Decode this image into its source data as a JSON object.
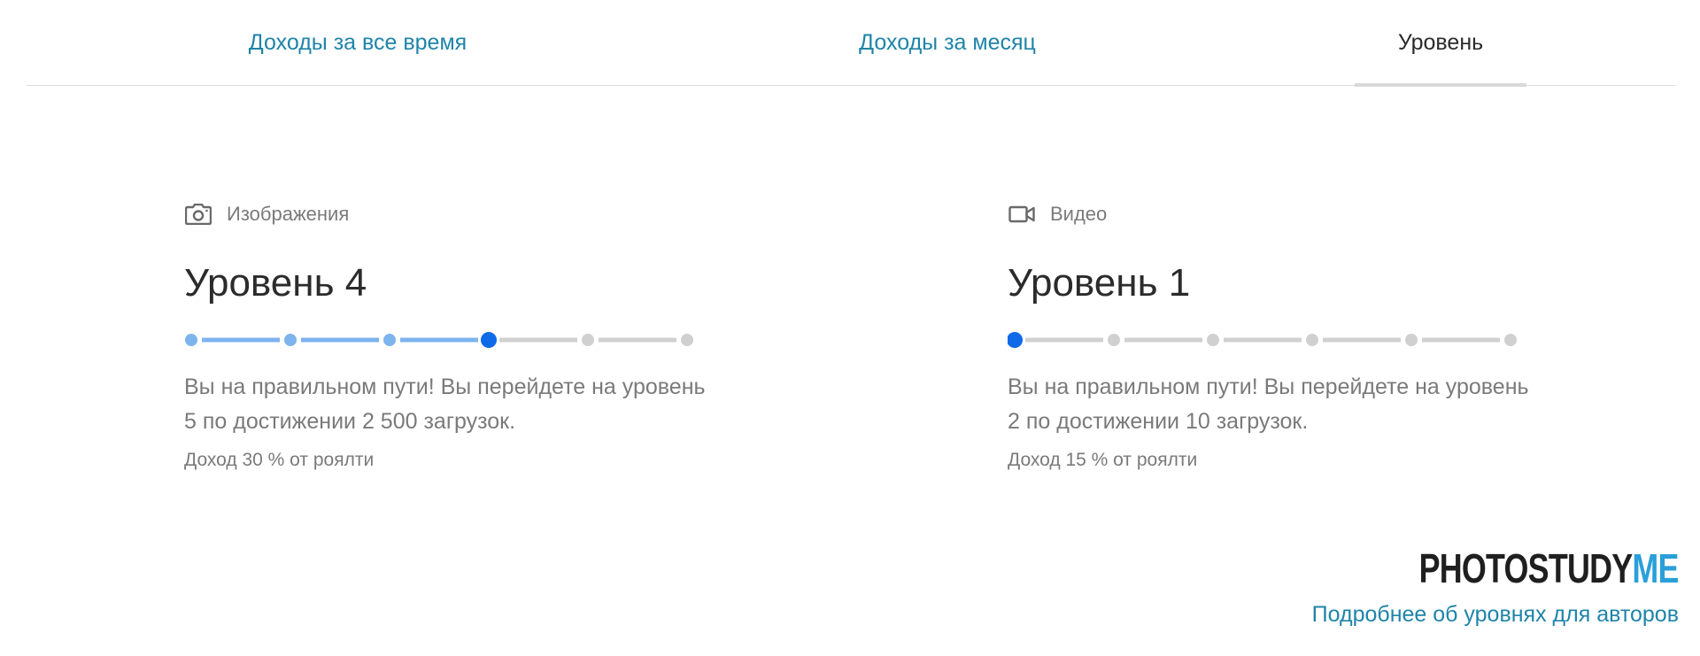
{
  "tabs": [
    {
      "label": "Доходы за все время",
      "active": false
    },
    {
      "label": "Доходы за месяц",
      "active": false
    },
    {
      "label": "Уровень",
      "active": true
    }
  ],
  "levels": [
    {
      "icon": "camera-icon",
      "type_label": "Изображения",
      "title": "Уровень 4",
      "current_level": 4,
      "total_levels": 6,
      "description": "Вы на правильном пути! Вы перейдете на уровень 5 по достижении 2 500 загрузок.",
      "royalty": "Доход 30 % от роялти"
    },
    {
      "icon": "video-camera-icon",
      "type_label": "Видео",
      "title": "Уровень 1",
      "current_level": 1,
      "total_levels": 6,
      "description": "Вы на правильном пути! Вы перейдете на уровень 2 по достижении 10 загрузок.",
      "royalty": "Доход 15 % от роялти"
    }
  ],
  "colors": {
    "link": "#1f84a9",
    "progress_done": "#7eb4ee",
    "progress_current": "#0f6ae8",
    "progress_todo": "#d0d0d0",
    "logo_accent": "#2b9fd8"
  },
  "logo": {
    "part1": "PHOTOSTUDY",
    "part2": "ME"
  },
  "footer": {
    "more_link": "Подробнее об уровнях для авторов"
  }
}
